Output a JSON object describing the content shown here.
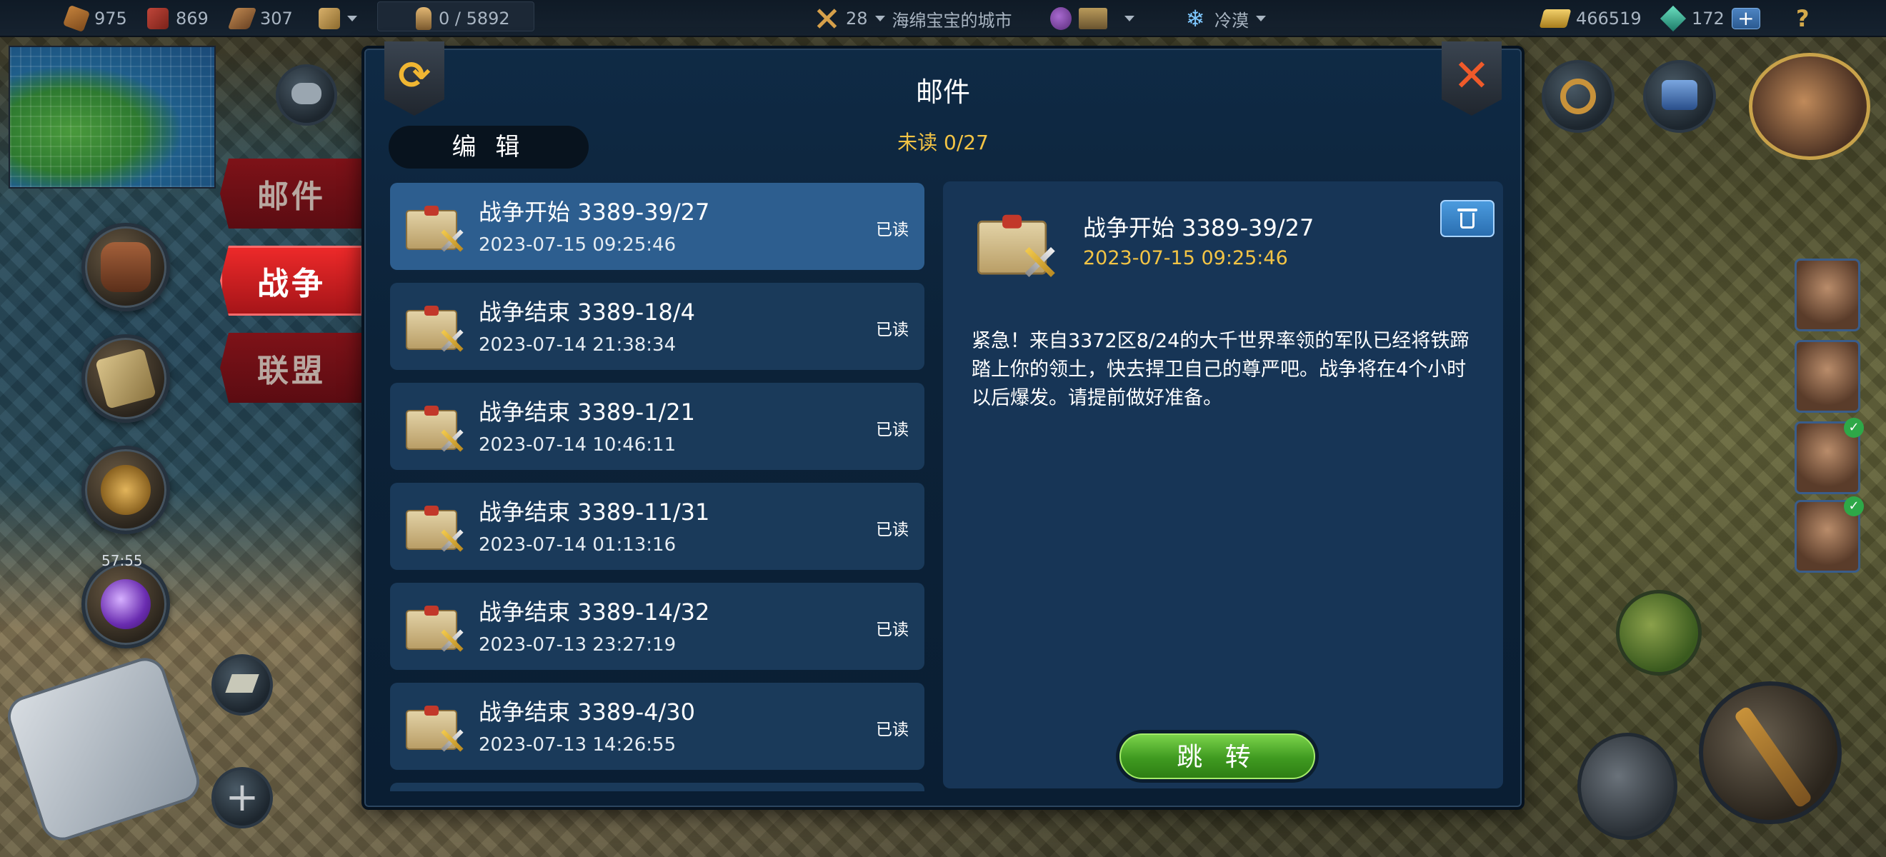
{
  "top_bar": {
    "resources": [
      {
        "icon": "wood-icon",
        "value": "975"
      },
      {
        "icon": "brick-icon",
        "value": "869"
      },
      {
        "icon": "plank-icon",
        "value": "307"
      }
    ],
    "population": "0 / 5892",
    "level": "28",
    "city_name": "海绵宝宝的城市",
    "weather": "冷漠",
    "gold": "466519",
    "gems": "172",
    "add_gems_label": "+",
    "help_label": "?"
  },
  "left_panel": {
    "timer": "57:55",
    "add_label": "+"
  },
  "category_tabs": [
    {
      "label": "邮件",
      "active": false
    },
    {
      "label": "战争",
      "active": true
    },
    {
      "label": "联盟",
      "active": false
    }
  ],
  "dialog": {
    "title": "邮件",
    "edit_label": "编 辑",
    "unread": "未读 0/27",
    "refresh_icon": "refresh-icon",
    "close_icon": "close-icon"
  },
  "mails": [
    {
      "title": "战争开始 3389-39/27",
      "date": "2023-07-15 09:25:46",
      "status": "已读",
      "selected": true
    },
    {
      "title": "战争结束 3389-18/4",
      "date": "2023-07-14 21:38:34",
      "status": "已读",
      "selected": false
    },
    {
      "title": "战争结束 3389-1/21",
      "date": "2023-07-14 10:46:11",
      "status": "已读",
      "selected": false
    },
    {
      "title": "战争结束 3389-11/31",
      "date": "2023-07-14 01:13:16",
      "status": "已读",
      "selected": false
    },
    {
      "title": "战争结束 3389-14/32",
      "date": "2023-07-13 23:27:19",
      "status": "已读",
      "selected": false
    },
    {
      "title": "战争结束 3389-4/30",
      "date": "2023-07-13 14:26:55",
      "status": "已读",
      "selected": false
    }
  ],
  "detail": {
    "title": "战争开始 3389-39/27",
    "date": "2023-07-15 09:25:46",
    "body": "紧急！来自3372区8/24的大千世界率领的军队已经将铁蹄踏上你的领土，快去捍卫自己的尊严吧。战争将在4个小时以后爆发。请提前做好准备。",
    "jump_label": "跳 转",
    "delete_icon": "trash-icon"
  },
  "colors": {
    "accent_gold": "#f3c445",
    "selected_row": "#2d5e8f",
    "row": "#1a3a5a",
    "tab_active": "#ef2a2a",
    "jump_green": "#4fb22a"
  }
}
